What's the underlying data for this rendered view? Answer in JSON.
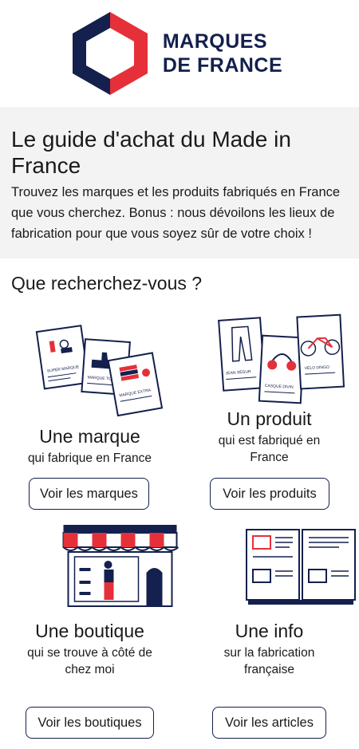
{
  "logo": {
    "line1": "MARQUES",
    "line2": "DE FRANCE"
  },
  "intro": {
    "title": "Le guide d'achat du Made in France",
    "description": "Trouvez les marques et les produits fabriqués en France que vous cherchez. Bonus : nous dévoilons les lieux de fabrication pour que vous soyez sûr de votre choix !"
  },
  "question": "Que recherchez-vous ?",
  "cards": [
    {
      "title": "Une marque",
      "subtitle": "qui fabrique en France",
      "button": "Voir les marques",
      "illus_labels": [
        "SUPER MARQUE",
        "MARQUE TOP",
        "MARQUE EXTRA"
      ]
    },
    {
      "title": "Un produit",
      "subtitle": "qui est fabriqué en France",
      "button": "Voir les produits",
      "illus_labels": [
        "JEAN SÉGUR",
        "CASQUE DIVIN",
        "VÉLO DINGO"
      ]
    },
    {
      "title": "Une boutique",
      "subtitle": "qui se trouve à côté de chez moi",
      "button": "Voir les boutiques"
    },
    {
      "title": "Une info",
      "subtitle": "sur la fabrication française",
      "button": "Voir les articles"
    }
  ],
  "colors": {
    "navy": "#14204d",
    "red": "#e5303a",
    "grey_bg": "#f3f3f3"
  }
}
